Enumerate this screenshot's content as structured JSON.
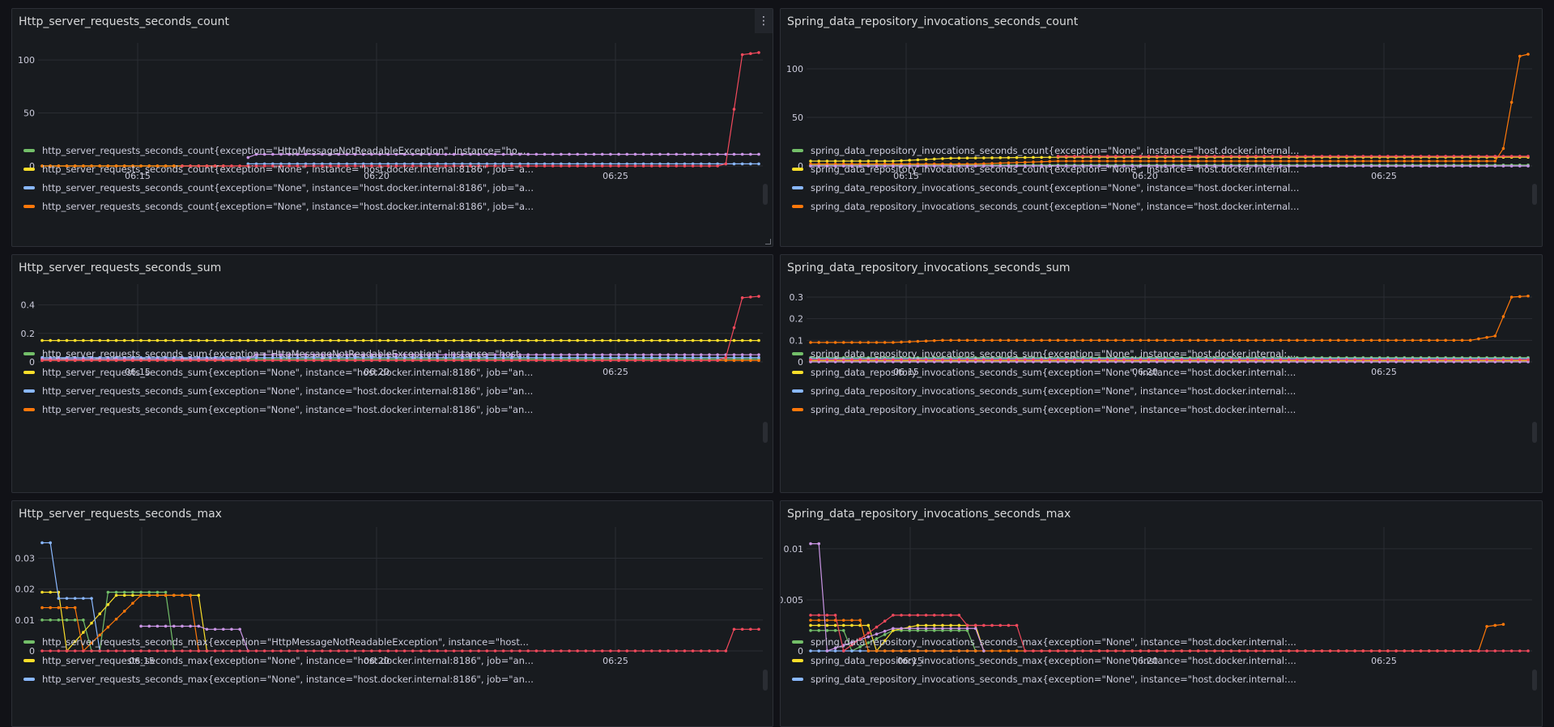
{
  "panels": [
    {
      "title": "Http_server_requests_seconds_count",
      "menu_icon": "more-vertical-icon",
      "chart_data": {
        "type": "line",
        "x_ticks": [
          "06:15",
          "06:20",
          "06:25"
        ],
        "y_ticks": [
          "0",
          "50",
          "100"
        ],
        "ylim": [
          0,
          110
        ],
        "series": [
          {
            "name": "http_server_requests_seconds_count{exception=\"HttpMessageNotReadableException\", instance=\"ho...",
            "color": "#73bf69",
            "values": [
              [
                0,
                0
              ],
              [
                22,
                0
              ]
            ]
          },
          {
            "name": "http_server_requests_seconds_count{exception=\"None\", instance=\"host.docker.internal:8186\", job=\"a...",
            "color": "#fade2a",
            "values": [
              [
                0,
                0
              ],
              [
                22,
                0
              ]
            ]
          },
          {
            "name": "http_server_requests_seconds_count{exception=\"None\", instance=\"host.docker.internal:8186\", job=\"a...",
            "color": "#8ab8ff",
            "values": [
              [
                25,
                2
              ],
              [
                87,
                2
              ]
            ]
          },
          {
            "name": "http_server_requests_seconds_count{exception=\"None\", instance=\"host.docker.internal:8186\", job=\"a...",
            "color": "#ff780a",
            "values": [
              [
                0,
                0
              ],
              [
                25,
                0
              ]
            ]
          },
          {
            "name": "",
            "color": "#ca95e5",
            "values": [
              [
                25,
                8
              ],
              [
                26,
                11
              ],
              [
                87,
                11
              ]
            ]
          },
          {
            "name": "",
            "color": "#f2495c",
            "values": [
              [
                17,
                0
              ],
              [
                82,
                0
              ],
              [
                83,
                2
              ],
              [
                85,
                105
              ],
              [
                87,
                107
              ]
            ]
          }
        ]
      }
    },
    {
      "title": "Spring_data_repository_invocations_seconds_count",
      "chart_data": {
        "type": "line",
        "x_ticks": [
          "06:15",
          "06:20",
          "06:25"
        ],
        "y_ticks": [
          "0",
          "50",
          "100"
        ],
        "ylim": [
          0,
          120
        ],
        "series": [
          {
            "name": "spring_data_repository_invocations_seconds_count{exception=\"None\", instance=\"host.docker.internal...",
            "color": "#73bf69",
            "values": [
              [
                0,
                1
              ],
              [
                87,
                1
              ]
            ]
          },
          {
            "name": "spring_data_repository_invocations_seconds_count{exception=\"None\", instance=\"host.docker.internal...",
            "color": "#fade2a",
            "values": [
              [
                0,
                5
              ],
              [
                10,
                5
              ],
              [
                17,
                8
              ],
              [
                30,
                9
              ],
              [
                87,
                9
              ]
            ]
          },
          {
            "name": "spring_data_repository_invocations_seconds_count{exception=\"None\", instance=\"host.docker.internal...",
            "color": "#8ab8ff",
            "values": [
              [
                0,
                0
              ],
              [
                87,
                0
              ]
            ]
          },
          {
            "name": "spring_data_repository_invocations_seconds_count{exception=\"None\", instance=\"host.docker.internal...",
            "color": "#ff780a",
            "values": [
              [
                0,
                2
              ],
              [
                20,
                2
              ],
              [
                30,
                5
              ],
              [
                83,
                5
              ],
              [
                84,
                18
              ],
              [
                86,
                113
              ],
              [
                87,
                115
              ]
            ]
          },
          {
            "name": "",
            "color": "#f2495c",
            "values": [
              [
                30,
                10
              ],
              [
                87,
                10
              ]
            ]
          },
          {
            "name": "",
            "color": "#ca95e5",
            "values": [
              [
                0,
                0
              ],
              [
                87,
                0
              ]
            ]
          }
        ]
      }
    },
    {
      "title": "Http_server_requests_seconds_sum",
      "chart_data": {
        "type": "line",
        "x_ticks": [
          "06:15",
          "06:20",
          "06:25"
        ],
        "y_ticks": [
          "0",
          "0.2",
          "0.4"
        ],
        "ylim": [
          0,
          0.5
        ],
        "series": [
          {
            "name": "http_server_requests_seconds_sum{exception=\"HttpMessageNotReadableException\", instance=\"host...",
            "color": "#73bf69",
            "values": [
              [
                0,
                0.02
              ],
              [
                87,
                0.02
              ]
            ]
          },
          {
            "name": "http_server_requests_seconds_sum{exception=\"None\", instance=\"host.docker.internal:8186\", job=\"an...",
            "color": "#fade2a",
            "values": [
              [
                0,
                0.15
              ],
              [
                87,
                0.15
              ]
            ]
          },
          {
            "name": "http_server_requests_seconds_sum{exception=\"None\", instance=\"host.docker.internal:8186\", job=\"an...",
            "color": "#8ab8ff",
            "values": [
              [
                0,
                0.03
              ],
              [
                87,
                0.03
              ]
            ]
          },
          {
            "name": "http_server_requests_seconds_sum{exception=\"None\", instance=\"host.docker.internal:8186\", job=\"an...",
            "color": "#ff780a",
            "values": [
              [
                0,
                0.01
              ],
              [
                87,
                0.01
              ]
            ]
          },
          {
            "name": "",
            "color": "#ca95e5",
            "values": [
              [
                0,
                0.02
              ],
              [
                25,
                0.02
              ],
              [
                26,
                0.05
              ],
              [
                87,
                0.05
              ]
            ]
          },
          {
            "name": "",
            "color": "#f2495c",
            "values": [
              [
                0,
                0.01
              ],
              [
                82,
                0.01
              ],
              [
                83,
                0.03
              ],
              [
                85,
                0.45
              ],
              [
                87,
                0.46
              ]
            ]
          }
        ]
      }
    },
    {
      "title": "Spring_data_repository_invocations_seconds_sum",
      "chart_data": {
        "type": "line",
        "x_ticks": [
          "06:15",
          "06:20",
          "06:25"
        ],
        "y_ticks": [
          "0",
          "0.1",
          "0.2",
          "0.3"
        ],
        "ylim": [
          0,
          0.33
        ],
        "series": [
          {
            "name": "spring_data_repository_invocations_seconds_sum{exception=\"None\", instance=\"host.docker.internal:...",
            "color": "#73bf69",
            "values": [
              [
                0,
                0.02
              ],
              [
                87,
                0.02
              ]
            ]
          },
          {
            "name": "spring_data_repository_invocations_seconds_sum{exception=\"None\", instance=\"host.docker.internal:...",
            "color": "#fade2a",
            "values": [
              [
                0,
                0.005
              ],
              [
                87,
                0.005
              ]
            ]
          },
          {
            "name": "spring_data_repository_invocations_seconds_sum{exception=\"None\", instance=\"host.docker.internal:...",
            "color": "#8ab8ff",
            "values": [
              [
                0,
                0.015
              ],
              [
                87,
                0.015
              ]
            ]
          },
          {
            "name": "spring_data_repository_invocations_seconds_sum{exception=\"None\", instance=\"host.docker.internal:...",
            "color": "#ff780a",
            "values": [
              [
                0,
                0.09
              ],
              [
                10,
                0.09
              ],
              [
                16,
                0.1
              ],
              [
                80,
                0.1
              ],
              [
                83,
                0.12
              ],
              [
                85,
                0.3
              ],
              [
                87,
                0.305
              ]
            ]
          },
          {
            "name": "",
            "color": "#ca95e5",
            "values": [
              [
                0,
                0.0
              ],
              [
                87,
                0.0
              ]
            ]
          },
          {
            "name": "",
            "color": "#f2495c",
            "values": [
              [
                0,
                0.01
              ],
              [
                87,
                0.01
              ]
            ]
          }
        ]
      }
    },
    {
      "title": "Http_server_requests_seconds_max",
      "chart_data": {
        "type": "line",
        "x_ticks": [
          "06:15",
          "06:20",
          "06:25"
        ],
        "y_ticks": [
          "0",
          "0.01",
          "0.02",
          "0.03"
        ],
        "ylim": [
          0,
          0.038
        ],
        "series": [
          {
            "name": "http_server_requests_seconds_max{exception=\"HttpMessageNotReadableException\", instance=\"host...",
            "color": "#73bf69",
            "values": [
              [
                0,
                0.01
              ],
              [
                5,
                0.01
              ],
              [
                6,
                0
              ],
              [
                7,
                0
              ],
              [
                8,
                0.019
              ],
              [
                15,
                0.019
              ],
              [
                16,
                0
              ]
            ]
          },
          {
            "name": "http_server_requests_seconds_max{exception=\"None\", instance=\"host.docker.internal:8186\", job=\"an...",
            "color": "#fade2a",
            "values": [
              [
                0,
                0.019
              ],
              [
                2,
                0.019
              ],
              [
                3,
                0
              ],
              [
                9,
                0.018
              ],
              [
                19,
                0.018
              ],
              [
                20,
                0
              ]
            ]
          },
          {
            "name": "http_server_requests_seconds_max{exception=\"None\", instance=\"host.docker.internal:8186\", job=\"an...",
            "color": "#8ab8ff",
            "values": [
              [
                0,
                0.035
              ],
              [
                1,
                0.035
              ],
              [
                2,
                0.017
              ],
              [
                6,
                0.017
              ],
              [
                7,
                0
              ]
            ]
          },
          {
            "name": "",
            "color": "#ff780a",
            "values": [
              [
                0,
                0.014
              ],
              [
                4,
                0.014
              ],
              [
                5,
                0
              ],
              [
                12,
                0.018
              ],
              [
                18,
                0.018
              ],
              [
                19,
                0
              ]
            ]
          },
          {
            "name": "",
            "color": "#ca95e5",
            "values": [
              [
                12,
                0.008
              ],
              [
                19,
                0.008
              ],
              [
                20,
                0.007
              ],
              [
                24,
                0.007
              ],
              [
                25,
                0
              ]
            ]
          },
          {
            "name": "",
            "color": "#f2495c",
            "values": [
              [
                0,
                0
              ],
              [
                83,
                0
              ],
              [
                84,
                0.007
              ],
              [
                87,
                0.007
              ]
            ]
          }
        ]
      }
    },
    {
      "title": "Spring_data_repository_invocations_seconds_max",
      "chart_data": {
        "type": "line",
        "x_ticks": [
          "06:15",
          "06:20",
          "06:25"
        ],
        "y_ticks": [
          "0",
          "0.005",
          "0.01"
        ],
        "ylim": [
          0,
          0.0115
        ],
        "series": [
          {
            "name": "spring_data_repository_invocations_seconds_max{exception=\"None\", instance=\"host.docker.internal:...",
            "color": "#73bf69",
            "values": [
              [
                0,
                0.002
              ],
              [
                4,
                0.002
              ],
              [
                5,
                0
              ],
              [
                10,
                0.002
              ],
              [
                19,
                0.002
              ],
              [
                20,
                0
              ]
            ]
          },
          {
            "name": "spring_data_repository_invocations_seconds_max{exception=\"None\", instance=\"host.docker.internal:...",
            "color": "#fade2a",
            "values": [
              [
                0,
                0.0025
              ],
              [
                7,
                0.0025
              ],
              [
                8,
                0
              ],
              [
                10,
                0.002
              ],
              [
                13,
                0.0025
              ],
              [
                20,
                0.0025
              ],
              [
                21,
                0
              ]
            ]
          },
          {
            "name": "spring_data_repository_invocations_seconds_max{exception=\"None\", instance=\"host.docker.internal:...",
            "color": "#8ab8ff",
            "values": [
              [
                0,
                0
              ],
              [
                20,
                0
              ]
            ]
          },
          {
            "name": "",
            "color": "#ff780a",
            "values": [
              [
                0,
                0.003
              ],
              [
                6,
                0.003
              ],
              [
                7,
                0
              ],
              [
                81,
                0
              ],
              [
                82,
                0.0024
              ],
              [
                84,
                0.0026
              ]
            ]
          },
          {
            "name": "",
            "color": "#ca95e5",
            "values": [
              [
                0,
                0.0105
              ],
              [
                1,
                0.0105
              ],
              [
                2,
                0
              ],
              [
                10,
                0.0022
              ],
              [
                20,
                0.0022
              ],
              [
                21,
                0
              ]
            ]
          },
          {
            "name": "",
            "color": "#f2495c",
            "values": [
              [
                0,
                0.0035
              ],
              [
                3,
                0.0035
              ],
              [
                4,
                0
              ],
              [
                10,
                0.0035
              ],
              [
                18,
                0.0035
              ],
              [
                19,
                0.0025
              ],
              [
                25,
                0.0025
              ],
              [
                26,
                0
              ],
              [
                87,
                0
              ]
            ]
          }
        ]
      }
    }
  ]
}
